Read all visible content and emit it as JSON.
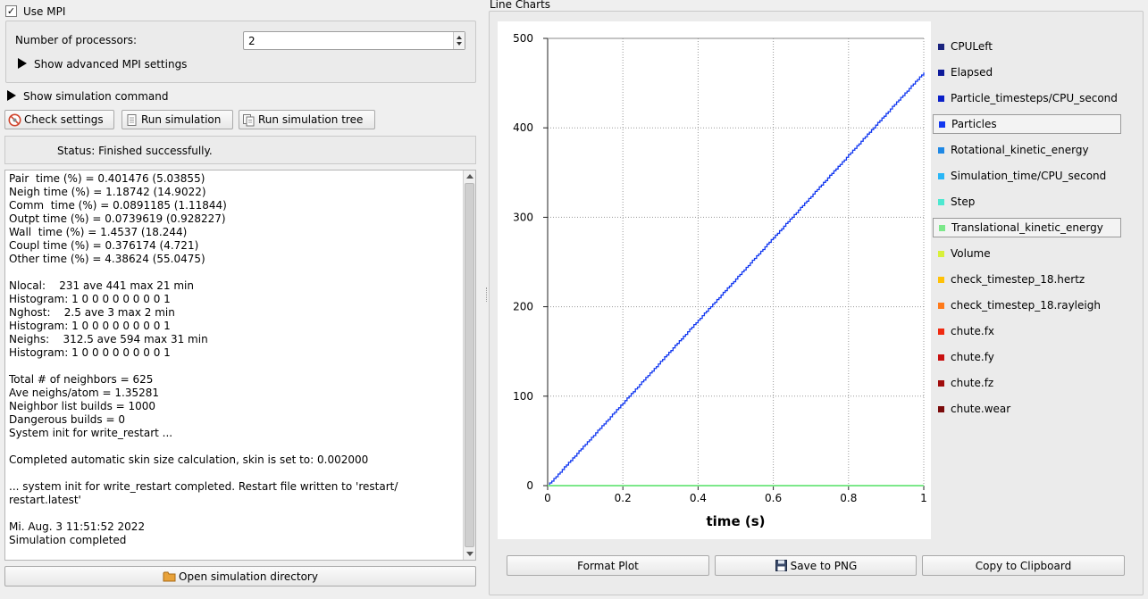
{
  "mpi": {
    "use_mpi_label": "Use MPI",
    "use_mpi_checked": true,
    "processors_label": "Number of processors:",
    "processors_value": "2",
    "advanced_label": "Show advanced MPI settings"
  },
  "simulation_command_label": "Show simulation command",
  "toolbar": {
    "check_settings": "Check settings",
    "run_simulation": "Run simulation",
    "run_simulation_tree": "Run simulation tree"
  },
  "status_text": "Status: Finished successfully.",
  "log_lines": [
    "Pair  time (%) = 0.401476 (5.03855)",
    "Neigh time (%) = 1.18742 (14.9022)",
    "Comm  time (%) = 0.0891185 (1.11844)",
    "Outpt time (%) = 0.0739619 (0.928227)",
    "Wall  time (%) = 1.4537 (18.244)",
    "Coupl time (%) = 0.376174 (4.721)",
    "Other time (%) = 4.38624 (55.0475)",
    "",
    "Nlocal:    231 ave 441 max 21 min",
    "Histogram: 1 0 0 0 0 0 0 0 0 1",
    "Nghost:    2.5 ave 3 max 2 min",
    "Histogram: 1 0 0 0 0 0 0 0 0 1",
    "Neighs:    312.5 ave 594 max 31 min",
    "Histogram: 1 0 0 0 0 0 0 0 0 1",
    "",
    "Total # of neighbors = 625",
    "Ave neighs/atom = 1.35281",
    "Neighbor list builds = 1000",
    "Dangerous builds = 0",
    "System init for write_restart ...",
    "",
    "Completed automatic skin size calculation, skin is set to: 0.002000",
    "",
    "... system init for write_restart completed. Restart file written to 'restart/",
    "restart.latest'",
    "",
    "Mi. Aug. 3 11:51:52 2022",
    "Simulation completed"
  ],
  "open_directory_label": "Open simulation directory",
  "chart_panel_title": "Line Charts",
  "chart_buttons": {
    "format_plot": "Format Plot",
    "save_png": "Save to PNG",
    "copy_clipboard": "Copy to Clipboard"
  },
  "legend": [
    {
      "name": "CPULeft",
      "color": "#1a237e",
      "selected": false
    },
    {
      "name": "Elapsed",
      "color": "#0d1a9a",
      "selected": false
    },
    {
      "name": "Particle_timesteps/CPU_second",
      "color": "#0a1fc8",
      "selected": false
    },
    {
      "name": "Particles",
      "color": "#1238f0",
      "selected": true
    },
    {
      "name": "Rotational_kinetic_energy",
      "color": "#1e88e5",
      "selected": false
    },
    {
      "name": "Simulation_time/CPU_second",
      "color": "#29b6f6",
      "selected": false
    },
    {
      "name": "Step",
      "color": "#4de8d0",
      "selected": false
    },
    {
      "name": "Translational_kinetic_energy",
      "color": "#7ce88a",
      "selected": true
    },
    {
      "name": "Volume",
      "color": "#d8f03a",
      "selected": false
    },
    {
      "name": "check_timestep_18.hertz",
      "color": "#ffc107",
      "selected": false
    },
    {
      "name": "check_timestep_18.rayleigh",
      "color": "#ff7a1a",
      "selected": false
    },
    {
      "name": "chute.fx",
      "color": "#f02a10",
      "selected": false
    },
    {
      "name": "chute.fy",
      "color": "#c81010",
      "selected": false
    },
    {
      "name": "chute.fz",
      "color": "#a00c0c",
      "selected": false
    },
    {
      "name": "chute.wear",
      "color": "#7a0a0a",
      "selected": false
    }
  ],
  "chart_data": {
    "type": "line",
    "xlabel": "time (s)",
    "ylabel": "",
    "xlim": [
      0,
      1
    ],
    "ylim": [
      0,
      500
    ],
    "x_ticks": [
      "0",
      "0.2",
      "0.4",
      "0.6",
      "0.8",
      "1"
    ],
    "y_ticks": [
      "0",
      "100",
      "200",
      "300",
      "400",
      "500"
    ],
    "grid": true,
    "legend_position": "right",
    "series": [
      {
        "name": "Particles",
        "color": "#1238f0",
        "x": [
          0,
          1
        ],
        "y": [
          0,
          462
        ],
        "style": "step"
      },
      {
        "name": "Translational_kinetic_energy",
        "color": "#7ce88a",
        "x": [
          0,
          1
        ],
        "y": [
          0,
          0
        ]
      }
    ]
  }
}
